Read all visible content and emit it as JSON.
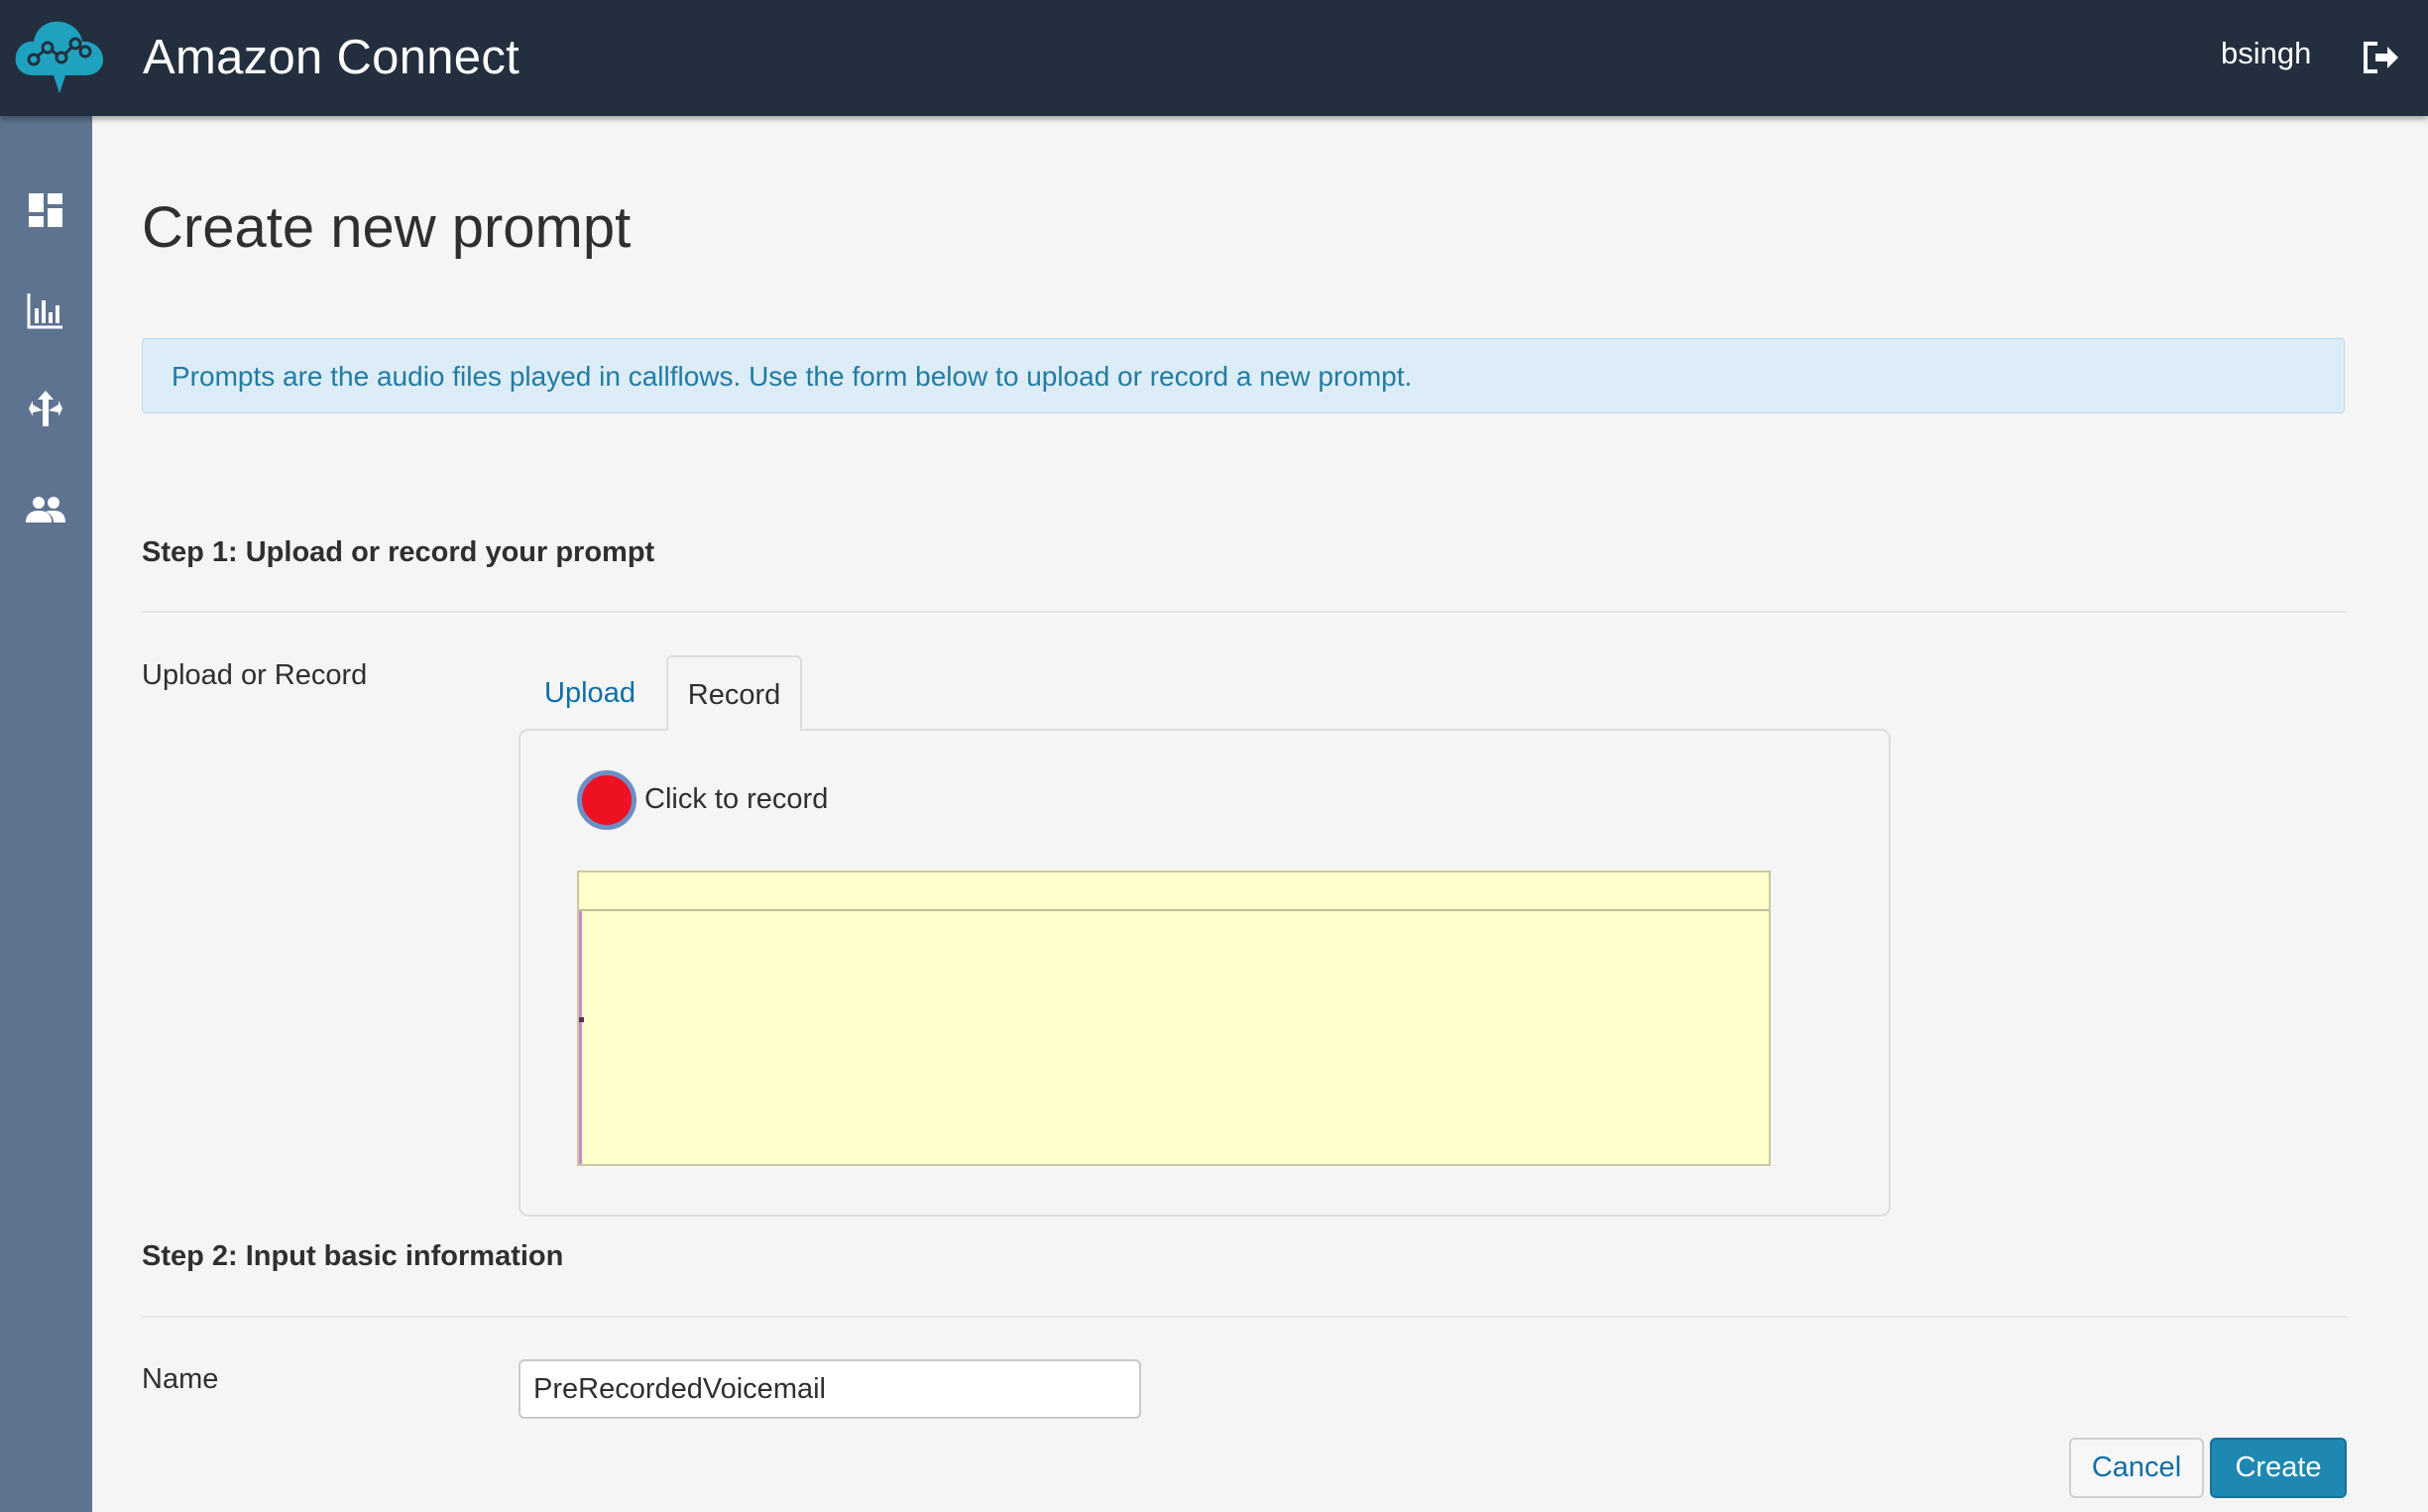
{
  "header": {
    "app_title": "Amazon Connect",
    "username": "bsingh",
    "logo_icon": "cloud-network-icon",
    "logout_icon": "logout-icon",
    "background_color": "#232f3e"
  },
  "sidebar": {
    "background_color": "#5e7390",
    "items": [
      {
        "icon": "dashboard-icon"
      },
      {
        "icon": "metrics-chart-icon"
      },
      {
        "icon": "routing-icon"
      },
      {
        "icon": "users-icon"
      }
    ]
  },
  "main": {
    "page_title": "Create new prompt",
    "info_text": "Prompts are the audio files played in callflows. Use the form below to upload or record a new prompt.",
    "step1": {
      "heading": "Step 1: Upload or record your prompt",
      "field_label": "Upload or Record",
      "tabs": [
        {
          "label": "Upload",
          "active": false
        },
        {
          "label": "Record",
          "active": true
        }
      ],
      "record_label": "Click to record",
      "record_button_color": "#ee1122"
    },
    "step2": {
      "heading": "Step 2: Input basic information",
      "name_label": "Name",
      "name_value": "PreRecordedVoicemail"
    }
  },
  "actions": {
    "cancel_label": "Cancel",
    "create_label": "Create",
    "primary_color": "#1f88b2"
  }
}
